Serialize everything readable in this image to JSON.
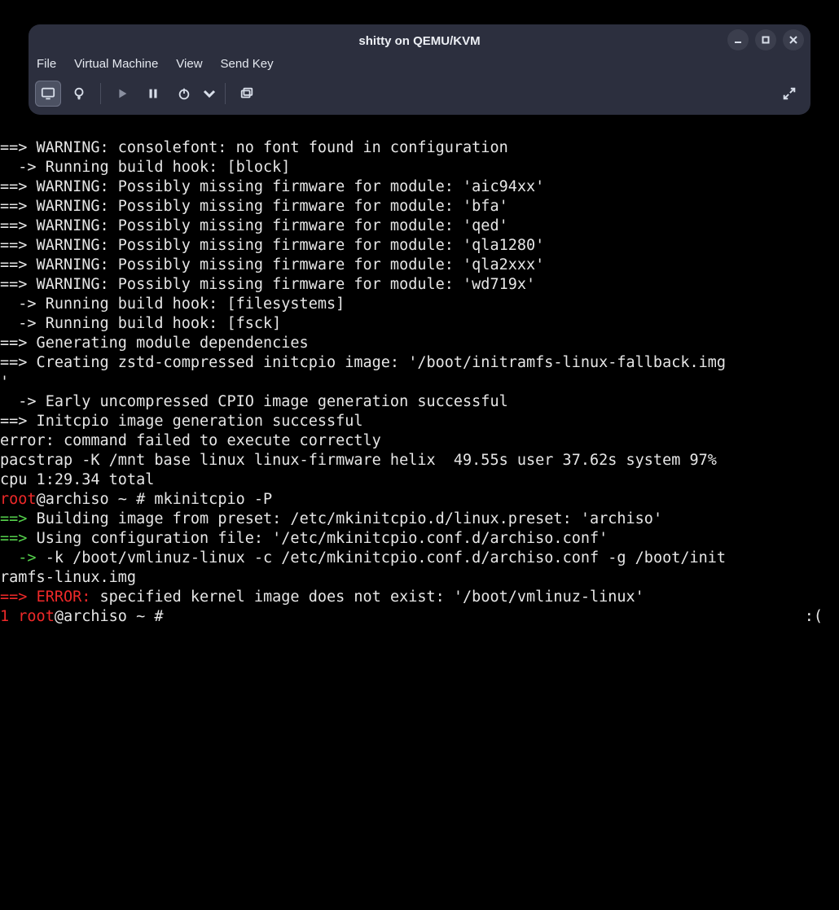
{
  "window": {
    "title": "shitty on QEMU/KVM"
  },
  "menu": {
    "file": "File",
    "vm": "Virtual Machine",
    "view": "View",
    "sendkey": "Send Key"
  },
  "terminal": {
    "lines": [
      {
        "segs": [
          {
            "t": "==> WARNING: consolefont: no font found in configuration"
          }
        ]
      },
      {
        "segs": [
          {
            "t": "  -> Running build hook: [block]"
          }
        ]
      },
      {
        "segs": [
          {
            "t": "==> WARNING: Possibly missing firmware for module: 'aic94xx'"
          }
        ]
      },
      {
        "segs": [
          {
            "t": "==> WARNING: Possibly missing firmware for module: 'bfa'"
          }
        ]
      },
      {
        "segs": [
          {
            "t": "==> WARNING: Possibly missing firmware for module: 'qed'"
          }
        ]
      },
      {
        "segs": [
          {
            "t": "==> WARNING: Possibly missing firmware for module: 'qla1280'"
          }
        ]
      },
      {
        "segs": [
          {
            "t": "==> WARNING: Possibly missing firmware for module: 'qla2xxx'"
          }
        ]
      },
      {
        "segs": [
          {
            "t": "==> WARNING: Possibly missing firmware for module: 'wd719x'"
          }
        ]
      },
      {
        "segs": [
          {
            "t": "  -> Running build hook: [filesystems]"
          }
        ]
      },
      {
        "segs": [
          {
            "t": "  -> Running build hook: [fsck]"
          }
        ]
      },
      {
        "segs": [
          {
            "t": "==> Generating module dependencies"
          }
        ]
      },
      {
        "segs": [
          {
            "t": "==> Creating zstd-compressed initcpio image: '/boot/initramfs-linux-fallback.img"
          }
        ]
      },
      {
        "segs": [
          {
            "t": "'"
          }
        ]
      },
      {
        "segs": [
          {
            "t": "  -> Early uncompressed CPIO image generation successful"
          }
        ]
      },
      {
        "segs": [
          {
            "t": "==> Initcpio image generation successful"
          }
        ]
      },
      {
        "segs": [
          {
            "t": "error: command failed to execute correctly"
          }
        ]
      },
      {
        "segs": [
          {
            "t": "pacstrap -K /mnt base linux linux-firmware helix  49.55s user 37.62s system 97%"
          }
        ]
      },
      {
        "segs": [
          {
            "t": "cpu 1:29.34 total"
          }
        ]
      },
      {
        "segs": [
          {
            "t": "root",
            "c": "r"
          },
          {
            "t": "@archiso ~ # mkinitcpio -P"
          }
        ]
      },
      {
        "segs": [
          {
            "t": "==> ",
            "c": "g"
          },
          {
            "t": "Building image from preset: /etc/mkinitcpio.d/linux.preset: 'archiso'"
          }
        ]
      },
      {
        "segs": [
          {
            "t": "==> ",
            "c": "g"
          },
          {
            "t": "Using configuration file: '/etc/mkinitcpio.conf.d/archiso.conf'"
          }
        ]
      },
      {
        "segs": [
          {
            "t": "  -> ",
            "c": "g"
          },
          {
            "t": "-k /boot/vmlinuz-linux -c /etc/mkinitcpio.conf.d/archiso.conf -g /boot/init"
          }
        ]
      },
      {
        "segs": [
          {
            "t": "ramfs-linux.img"
          }
        ]
      },
      {
        "segs": [
          {
            "t": "==> ",
            "c": "r"
          },
          {
            "t": "ERROR: ",
            "c": "r"
          },
          {
            "t": "specified kernel image does not exist: '/boot/vmlinuz-linux'"
          }
        ]
      },
      {
        "segs": [
          {
            "t": "1 ",
            "c": "r"
          },
          {
            "t": "root",
            "c": "r"
          },
          {
            "t": "@archiso ~ # "
          }
        ],
        "face": ":("
      }
    ]
  }
}
